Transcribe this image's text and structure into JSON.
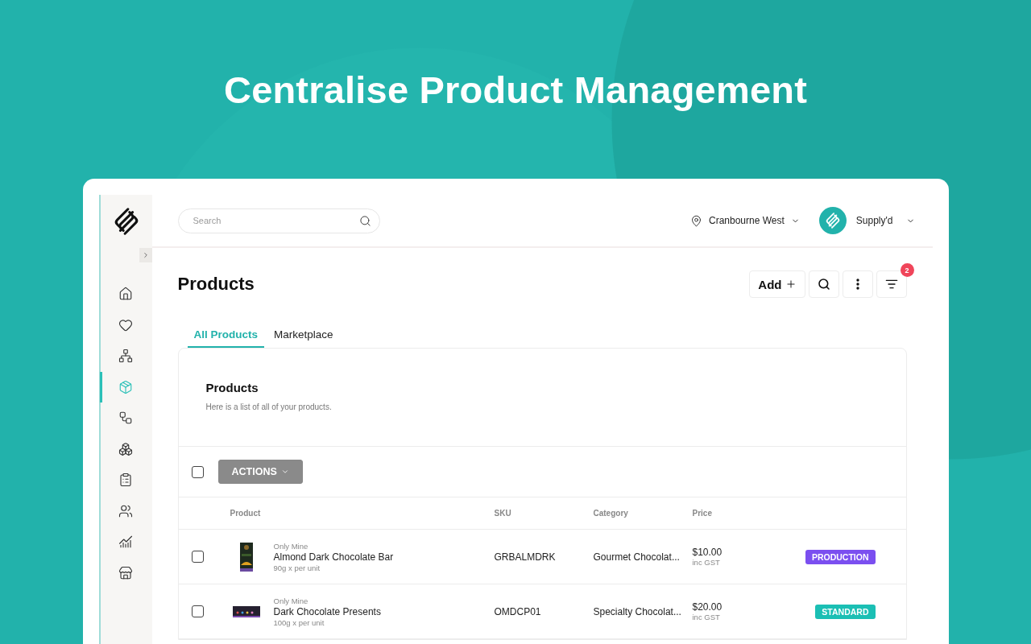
{
  "headline": "Centralise Product Management",
  "search": {
    "placeholder": "Search"
  },
  "location": {
    "label": "Cranbourne West"
  },
  "account": {
    "label": "Supply'd"
  },
  "sidebar": {
    "items": [
      {
        "kind": "home",
        "selected": false
      },
      {
        "kind": "heart",
        "selected": false
      },
      {
        "kind": "network",
        "selected": false
      },
      {
        "kind": "package",
        "selected": true
      },
      {
        "kind": "workflow",
        "selected": false
      },
      {
        "kind": "boxes",
        "selected": false
      },
      {
        "kind": "clipboard",
        "selected": false
      },
      {
        "kind": "users",
        "selected": false
      },
      {
        "kind": "chart",
        "selected": false
      },
      {
        "kind": "store",
        "selected": false
      }
    ]
  },
  "page": {
    "title": "Products",
    "add_label": "Add",
    "filter_count": "2"
  },
  "tabs": [
    {
      "label": "All Products",
      "selected": true
    },
    {
      "label": "Marketplace",
      "selected": false
    }
  ],
  "panel": {
    "title": "Products",
    "subtitle": "Here is a list of all of your products."
  },
  "actions": {
    "label": "ACTIONS",
    "select_all_checked": false
  },
  "table": {
    "columns": [
      "Product",
      "SKU",
      "Category",
      "Price"
    ],
    "rows": [
      {
        "checked": false,
        "brand": "Only Mine",
        "name": "Almond Dark Chocolate Bar",
        "size": "90g x per unit",
        "sku": "GRBALMDRK",
        "category": "Gourmet Chocolat...",
        "price": "$10.00",
        "tax": "inc GST",
        "status": "PRODUCTION",
        "color": "#7b4ff0"
      },
      {
        "checked": false,
        "brand": "Only Mine",
        "name": "Dark Chocolate Presents",
        "size": "100g x per unit",
        "sku": "OMDCP01",
        "category": "Specialty Chocolat...",
        "price": "$20.00",
        "tax": "inc GST",
        "status": "STANDARD",
        "color": "#1bbfb4"
      }
    ]
  }
}
